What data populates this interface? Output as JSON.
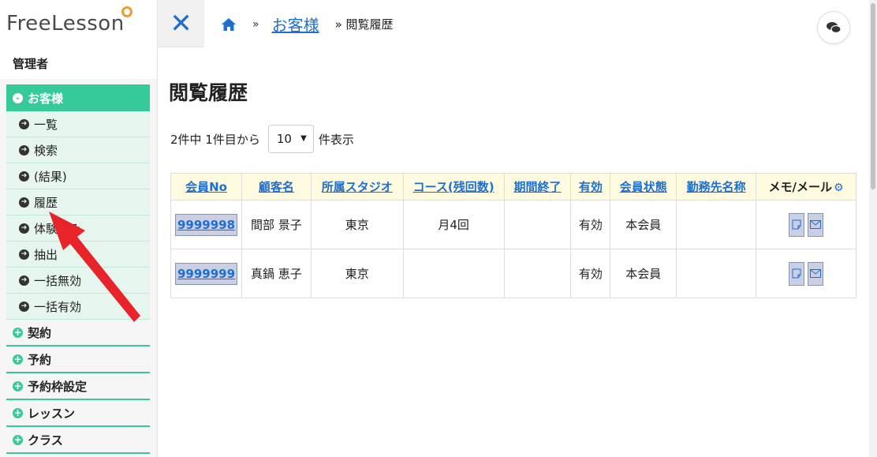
{
  "logo": {
    "text": "FreeLesson"
  },
  "sidebar": {
    "role": "管理者",
    "open_group": "お客様",
    "sub_items": [
      "一覧",
      "検索",
      "(結果)",
      "履歴",
      "体験済み",
      "抽出",
      "一括無効",
      "一括有効"
    ],
    "groups": [
      "契約",
      "予約",
      "予約枠設定",
      "レッスン",
      "クラス"
    ]
  },
  "breadcrumb": {
    "sep1": "»",
    "link": "お客様",
    "current": "» 閲覧履歴"
  },
  "page": {
    "title": "閲覧履歴",
    "pager_prefix": "2件中 1件目から",
    "per_page": "10",
    "pager_suffix": "件表示"
  },
  "table": {
    "headers": [
      "会員No",
      "顧客名",
      "所属スタジオ",
      "コース(残回数)",
      "期間終了",
      "有効",
      "会員状態",
      "勤務先名称",
      "メモ/メール"
    ],
    "rows": [
      {
        "id": "9999998",
        "name": "間部 景子",
        "studio": "東京",
        "course": "月4回",
        "end": "",
        "active": "有効",
        "status": "本会員",
        "work": ""
      },
      {
        "id": "9999999",
        "name": "真鍋 恵子",
        "studio": "東京",
        "course": "",
        "end": "",
        "active": "有効",
        "status": "本会員",
        "work": ""
      }
    ]
  },
  "colors": {
    "accent": "#36c99a",
    "link": "#1e6fcf",
    "header_bg": "#fffbe0",
    "arrow": "#e8232a"
  }
}
